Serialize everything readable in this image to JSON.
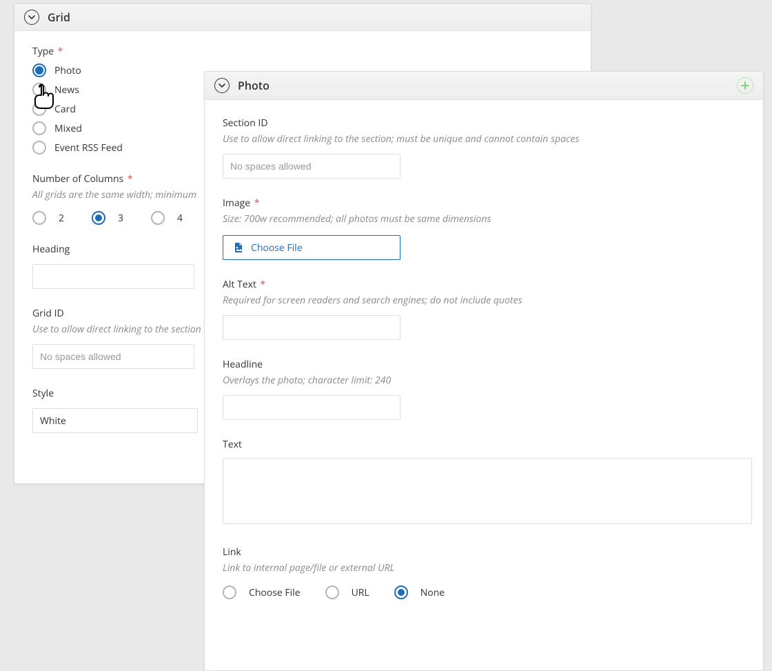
{
  "grid_panel": {
    "title": "Grid",
    "type": {
      "label": "Type",
      "required": true,
      "options": [
        {
          "label": "Photo",
          "selected": true
        },
        {
          "label": "News",
          "selected": false
        },
        {
          "label": "Card",
          "selected": false
        },
        {
          "label": "Mixed",
          "selected": false
        },
        {
          "label": "Event RSS Feed",
          "selected": false
        }
      ]
    },
    "columns": {
      "label": "Number of Columns",
      "required": true,
      "helper": "All grids are the same width; minimum",
      "options": [
        {
          "label": "2",
          "selected": false
        },
        {
          "label": "3",
          "selected": true
        },
        {
          "label": "4",
          "selected": false
        }
      ]
    },
    "heading": {
      "label": "Heading",
      "value": ""
    },
    "grid_id": {
      "label": "Grid ID",
      "helper": "Use to allow direct linking to the section",
      "placeholder": "No spaces allowed",
      "value": ""
    },
    "style": {
      "label": "Style",
      "value": "White"
    }
  },
  "photo_panel": {
    "title": "Photo",
    "section_id": {
      "label": "Section ID",
      "helper": "Use to allow direct linking to the section; must be unique and cannot contain spaces",
      "placeholder": "No spaces allowed",
      "value": ""
    },
    "image": {
      "label": "Image",
      "required": true,
      "helper": "Size: 700w recommended; all photos must be same dimensions",
      "choose_label": "Choose File"
    },
    "alt_text": {
      "label": "Alt Text",
      "required": true,
      "helper": "Required for screen readers and search engines; do not include quotes",
      "value": ""
    },
    "headline": {
      "label": "Headline",
      "helper": "Overlays the photo; character limit: 240",
      "value": ""
    },
    "text": {
      "label": "Text",
      "value": ""
    },
    "link": {
      "label": "Link",
      "helper": "Link to internal page/file or external URL",
      "options": [
        {
          "label": "Choose File",
          "selected": false
        },
        {
          "label": "URL",
          "selected": false
        },
        {
          "label": "None",
          "selected": true
        }
      ]
    }
  }
}
